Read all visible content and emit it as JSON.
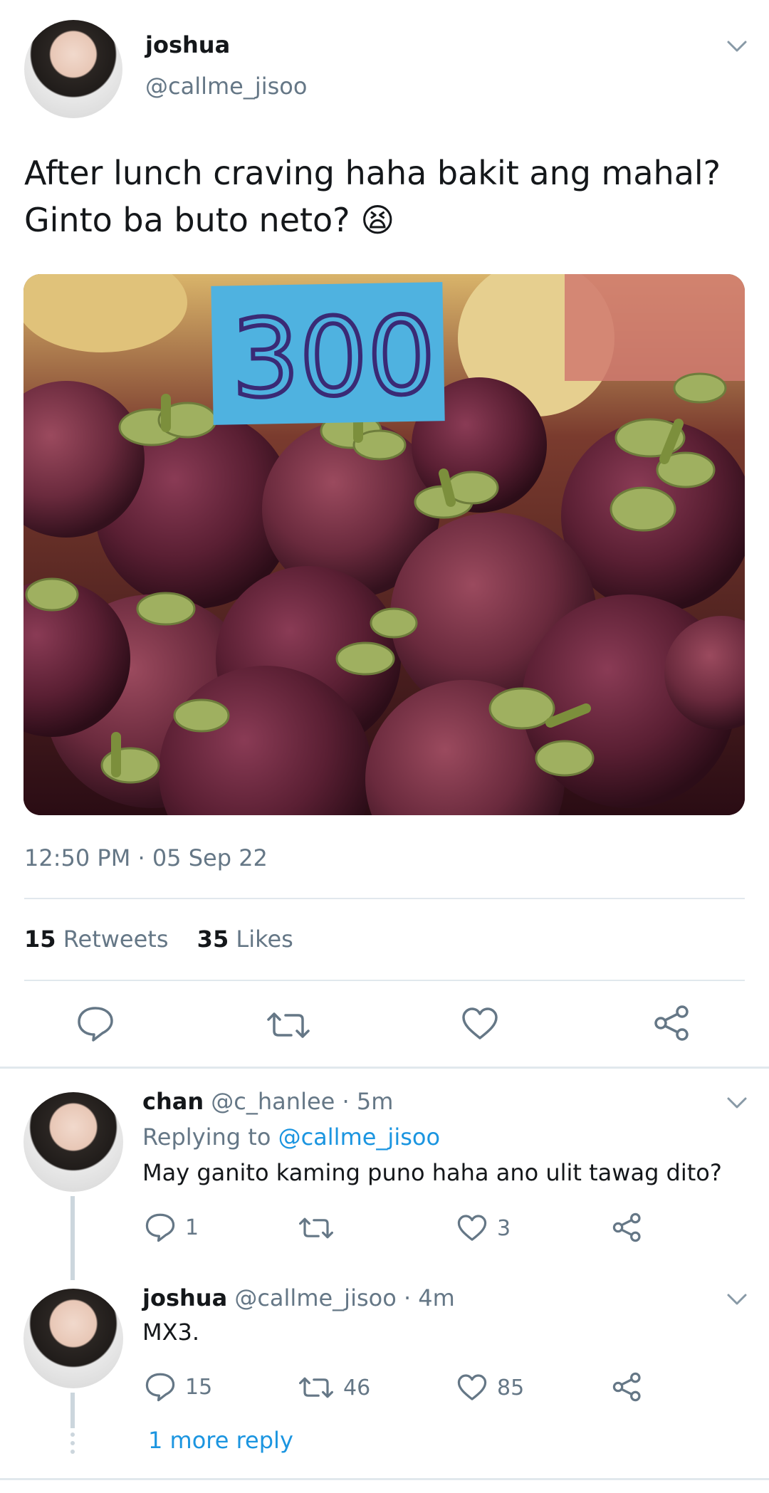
{
  "tweet": {
    "author_name": "joshua",
    "author_handle": "@callme_jisoo",
    "text_line1": "After lunch craving haha bakit ang mahal?",
    "text_line2": "Ginto ba buto neto?",
    "emoji": "😫",
    "image_price_label": "300",
    "timestamp": "12:50 PM · 05 Sep 22",
    "retweets_count": "15",
    "retweets_label": "Retweets",
    "likes_count": "35",
    "likes_label": "Likes"
  },
  "replies": [
    {
      "name": "chan",
      "handle": "@c_hanlee",
      "time": " · 5m",
      "replying_prefix": "Replying to",
      "replying_handle": "@callme_jisoo",
      "text": "May ganito kaming puno haha ano ulit tawag dito?",
      "reply_count": "1",
      "retweet_count": "",
      "like_count": "3"
    },
    {
      "name": "joshua",
      "handle": "@callme_jisoo",
      "time": " · 4m",
      "text": "MX3.",
      "reply_count": "15",
      "retweet_count": "46",
      "like_count": "85"
    }
  ],
  "more_replies_label": "1 more reply",
  "icons": [
    "chevron-down-icon",
    "reply-icon",
    "retweet-icon",
    "like-icon",
    "share-icon"
  ],
  "colors": {
    "text": "#14171a",
    "secondary": "#657786",
    "link": "#1b95e0",
    "divider": "#e1e8ed"
  }
}
